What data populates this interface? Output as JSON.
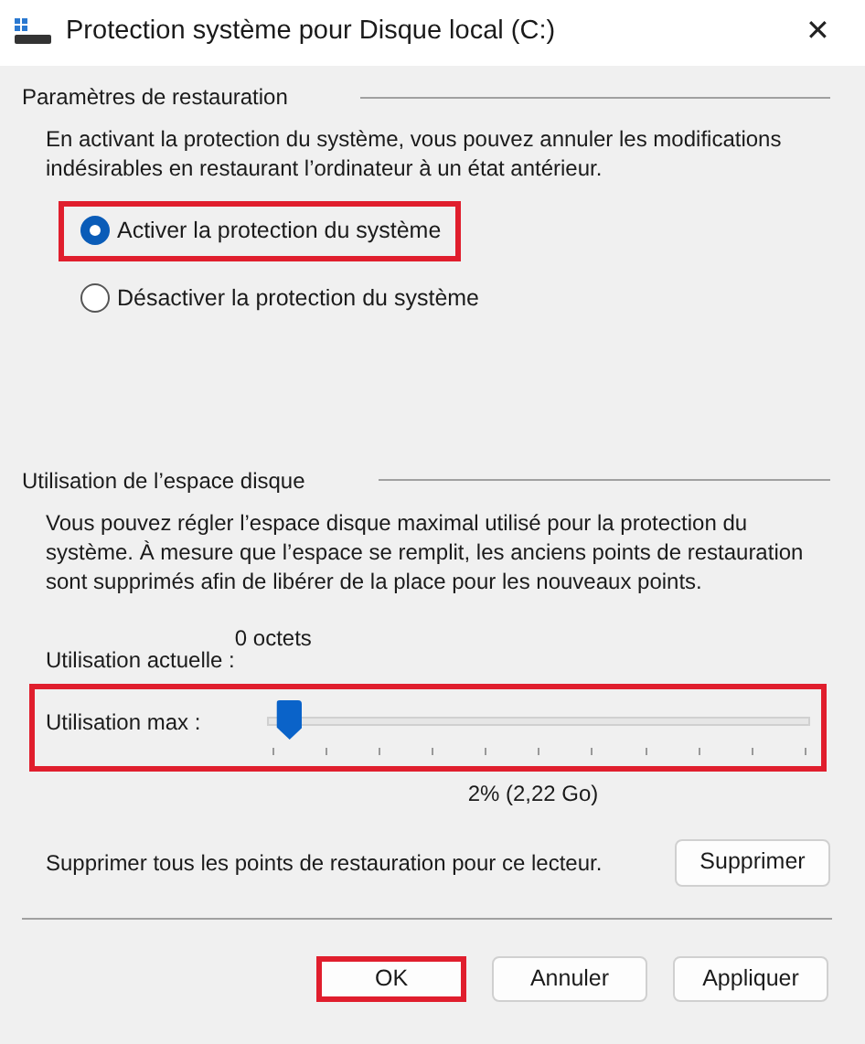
{
  "window": {
    "title": "Protection système pour Disque local (C:)",
    "close": "✕"
  },
  "restore_settings": {
    "heading": "Paramètres de restauration",
    "description": "En activant la protection du système, vous pouvez annuler les modifications indésirables en restaurant l’ordinateur à un état antérieur.",
    "options": [
      {
        "label": "Activer la protection du système",
        "selected": true,
        "highlighted": true
      },
      {
        "label": "Désactiver la protection du système",
        "selected": false,
        "highlighted": false
      }
    ]
  },
  "disk_usage": {
    "heading": "Utilisation de l’espace disque",
    "description": "Vous pouvez régler l’espace disque maximal utilisé pour la protection du système. À mesure que l’espace se remplit, les anciens points de restauration sont supprimés afin de libérer de la place pour les nouveaux points.",
    "current_label": "Utilisation actuelle :",
    "current_value": "0 octets",
    "max_label": "Utilisation max :",
    "level": 0.02,
    "highlighted": true,
    "max_value": "2% (2,22 Go)",
    "delete_text": "Supprimer tous les points de restauration pour ce lecteur.",
    "delete_button": "Supprimer"
  },
  "buttons": [
    {
      "label": "OK",
      "highlighted": true
    },
    {
      "label": "Annuler",
      "highlighted": false
    },
    {
      "label": "Appliquer",
      "highlighted": false
    }
  ]
}
